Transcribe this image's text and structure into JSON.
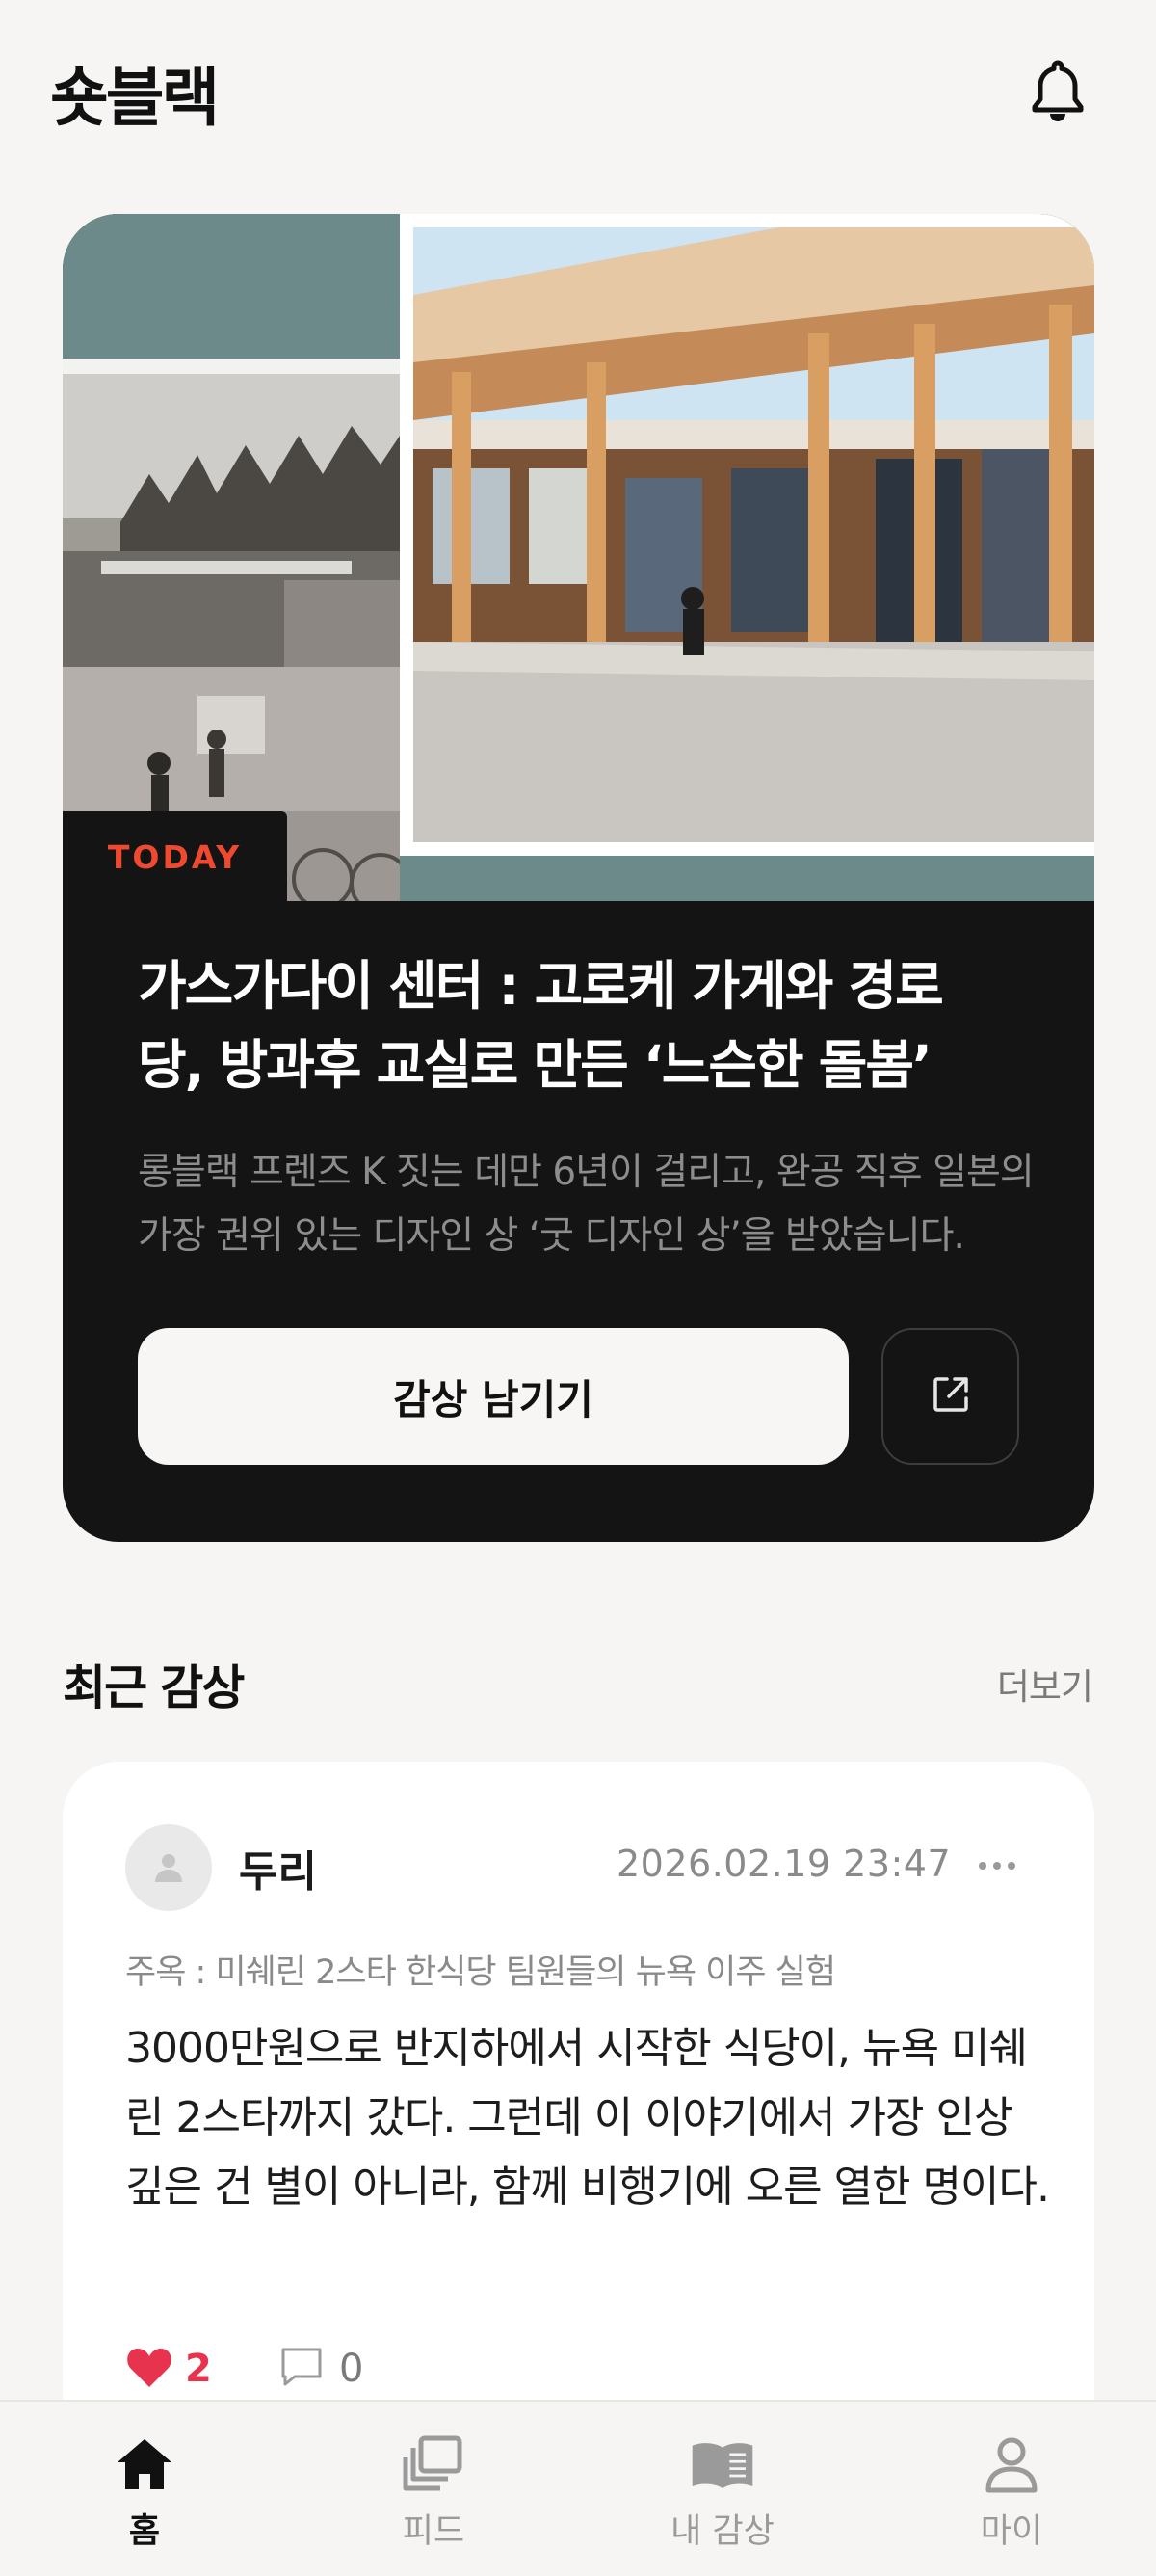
{
  "header": {
    "app_title": "숏블랙",
    "notification_icon": "bell-icon"
  },
  "today_card": {
    "tag": "TODAY",
    "title_line1": "가스가다이 센터 : 고로케 가게와 경로",
    "title_line2": "당, 방과후 교실로 만든 ‘느슨한 돌봄’",
    "excerpt": "롱블랙 프렌즈 K 짓는 데만 6년이 걸리고, 완공 직후 일본의 가장 권위 있는 디자인 상 ‘굿 디자인 상’을 받았습니다.",
    "primary_button": "감상 남기기",
    "share_icon": "external-link-icon",
    "colors": {
      "tag": "#ef4a2f",
      "card_bg": "#141414"
    }
  },
  "recent": {
    "section_title": "최근 감상",
    "more_label": "더보기",
    "review": {
      "author": "두리",
      "timestamp": "2026.02.19 23:47",
      "source": "주옥 : 미쉐린 2스타 한식당 팀원들의 뉴욕 이주 실험",
      "body": "3000만원으로 반지하에서 시작한 식당이, 뉴욕 미쉐린 2스타까지 갔다. 그런데 이 이야기에서 가장 인상 깊은 건 별이 아니라, 함께 비행기에 오른 열한 명이다.",
      "likes": "2",
      "comments": "0",
      "colors": {
        "like": "#e8334f"
      }
    }
  },
  "nav": {
    "items": [
      {
        "label": "홈",
        "icon": "home-icon",
        "active": true
      },
      {
        "label": "피드",
        "icon": "feed-icon",
        "active": false
      },
      {
        "label": "내 감상",
        "icon": "book-icon",
        "active": false
      },
      {
        "label": "마이",
        "icon": "person-icon",
        "active": false
      }
    ]
  }
}
